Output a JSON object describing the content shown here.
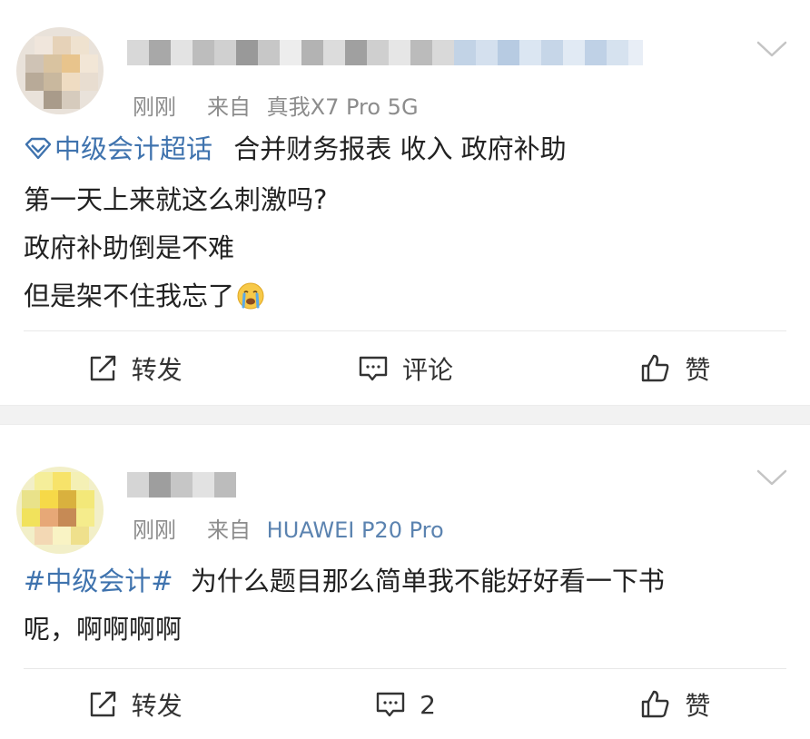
{
  "posts": [
    {
      "time": "刚刚",
      "source_prefix": "来自",
      "source_device": "真我X7 Pro 5G",
      "content": {
        "topic": "中级会计超话",
        "lines": [
          "合并财务报表 收入 政府补助",
          "第一天上来就这么刺激吗?",
          "政府补助倒是不难",
          "但是架不住我忘了"
        ],
        "emoji": "crying-face"
      },
      "actions": {
        "repost": "转发",
        "comment": "评论",
        "like": "赞"
      }
    },
    {
      "time": "刚刚",
      "source_prefix": "来自",
      "source_device": "HUAWEI P20 Pro",
      "content": {
        "hashtag": "#中级会计#",
        "line1_rest": "为什么题目那么简单我不能好好看一下书",
        "line2": "呢，啊啊啊啊"
      },
      "actions": {
        "repost": "转发",
        "comment": "2",
        "like": "赞"
      }
    }
  ],
  "colors": {
    "link": "#3f73ae",
    "meta": "#8c8c8c",
    "device_link": "#5b83b0",
    "separator": "#f2f2f2"
  },
  "icons": [
    "chevron-down-icon",
    "repost-icon",
    "comment-icon",
    "like-icon",
    "super-topic-icon",
    "crying-face-emoji"
  ]
}
